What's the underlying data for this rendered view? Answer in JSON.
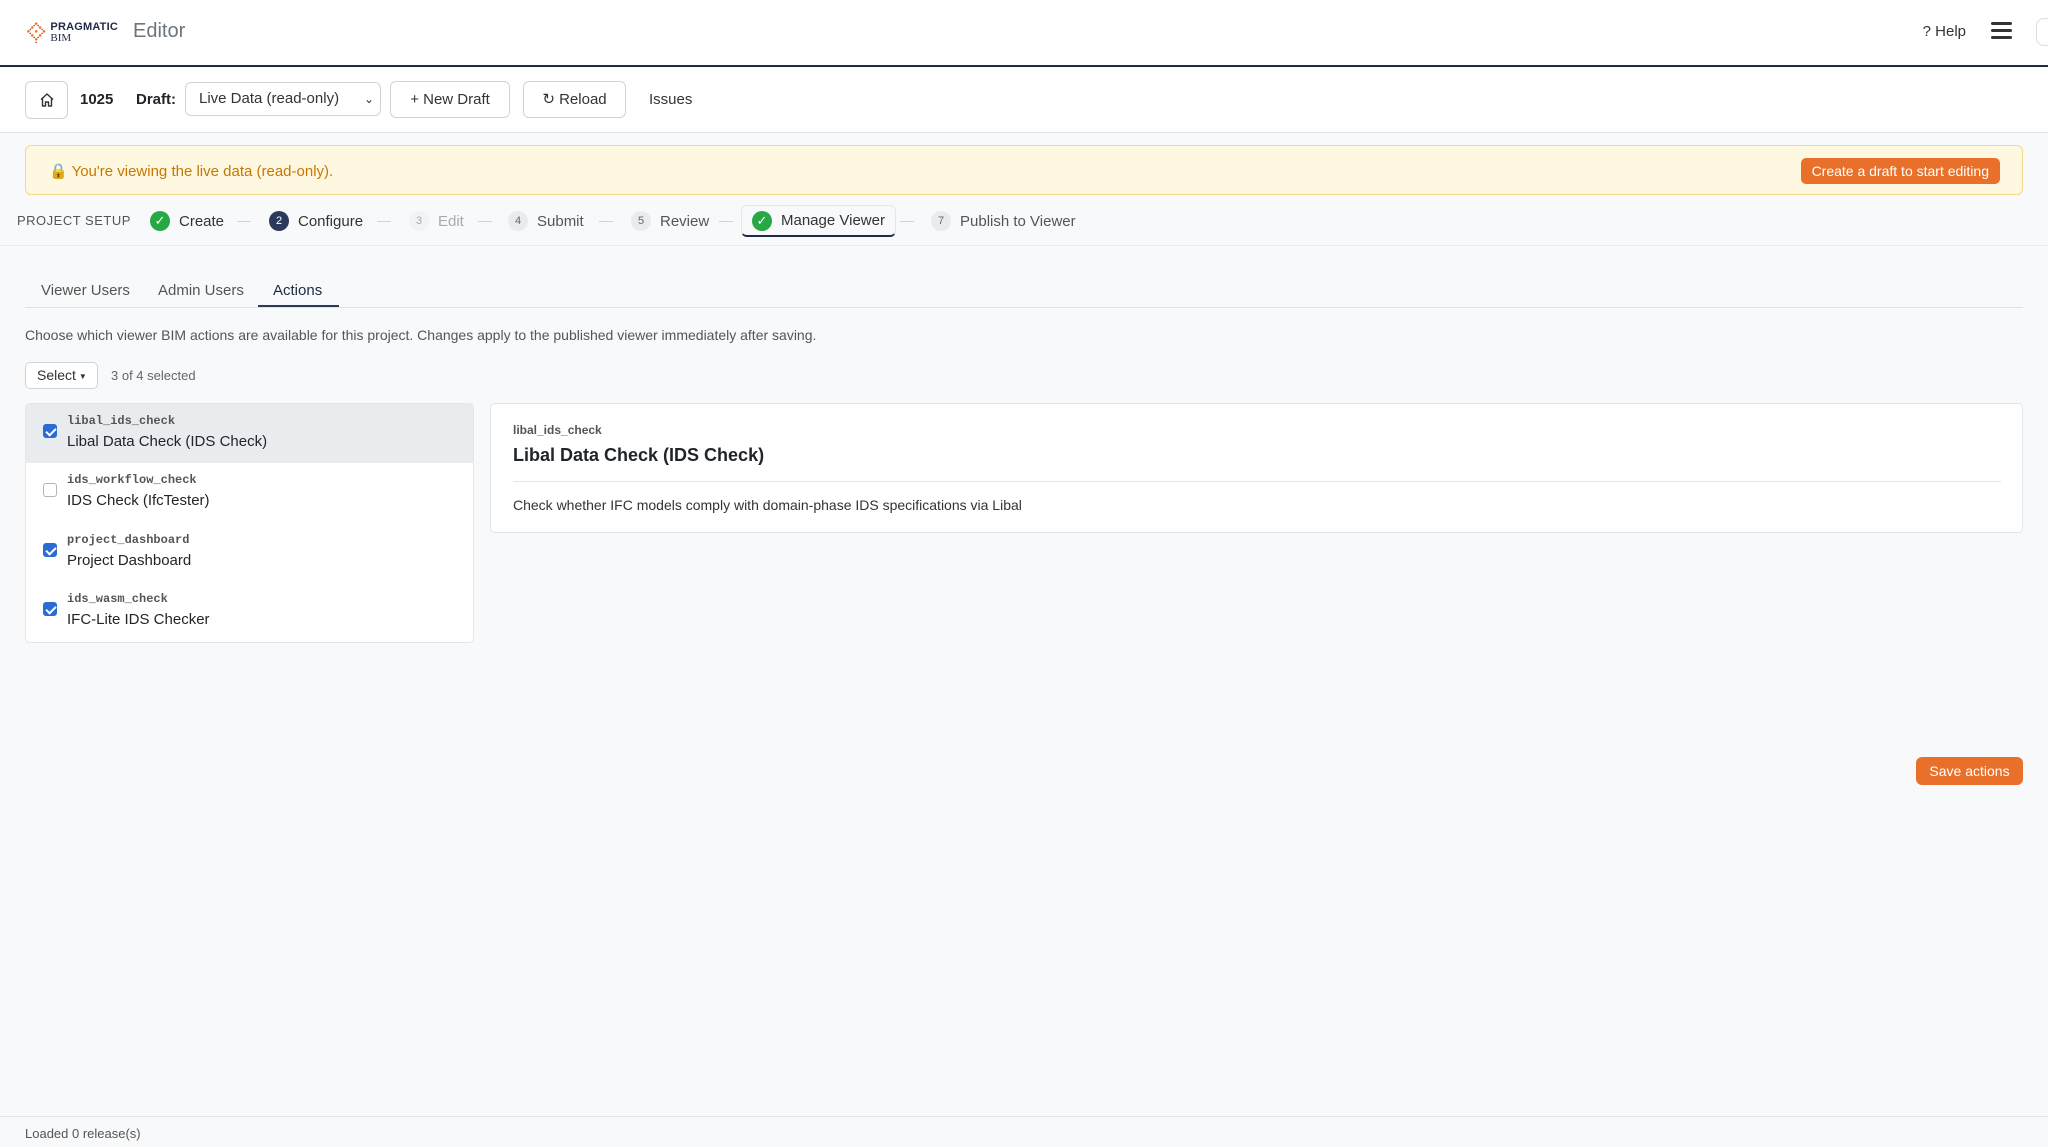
{
  "header": {
    "logo_line1": "PRAGMATIC",
    "logo_line2": "BIM",
    "app_title": "Editor",
    "help_label": "? Help",
    "menu_icon": "hamburger-icon"
  },
  "toolbar": {
    "home_icon": "home-icon",
    "project_id": "1025",
    "draft_label": "Draft:",
    "draft_value": "Live Data (read-only)",
    "new_draft_label": "+ New Draft",
    "reload_label": "↻ Reload",
    "issues_label": "Issues"
  },
  "alert": {
    "message": "🔒 You're viewing the live data (read-only).",
    "action_label": "Create a draft to start editing"
  },
  "stepper": {
    "title": "PROJECT SETUP",
    "steps": [
      {
        "badge": "✓",
        "label": "Create",
        "state": "done"
      },
      {
        "badge": "2",
        "label": "Configure",
        "state": "current"
      },
      {
        "badge": "3",
        "label": "Edit",
        "state": "disabled"
      },
      {
        "badge": "4",
        "label": "Submit",
        "state": "pending"
      },
      {
        "badge": "5",
        "label": "Review",
        "state": "pending"
      },
      {
        "badge": "✓",
        "label": "Manage Viewer",
        "state": "active"
      },
      {
        "badge": "7",
        "label": "Publish to Viewer",
        "state": "pending"
      }
    ]
  },
  "tabs": [
    {
      "label": "Viewer Users"
    },
    {
      "label": "Admin Users"
    },
    {
      "label": "Actions",
      "active": true
    }
  ],
  "description": "Choose which viewer BIM actions are available for this project. Changes apply to the published viewer immediately after saving.",
  "select": {
    "label": "Select",
    "count_text": "3 of 4 selected"
  },
  "actions": [
    {
      "key": "libal_ids_check",
      "name": "Libal Data Check (IDS Check)",
      "checked": true,
      "selected": true
    },
    {
      "key": "ids_workflow_check",
      "name": "IDS Check (IfcTester)",
      "checked": false,
      "selected": false
    },
    {
      "key": "project_dashboard",
      "name": "Project Dashboard",
      "checked": true,
      "selected": false
    },
    {
      "key": "ids_wasm_check",
      "name": "IFC-Lite IDS Checker",
      "checked": true,
      "selected": false
    }
  ],
  "detail": {
    "key": "libal_ids_check",
    "title": "Libal Data Check (IDS Check)",
    "description": "Check whether IFC models comply with domain-phase IDS specifications via Libal"
  },
  "save_label": "Save actions",
  "footer": {
    "status": "Loaded 0 release(s)"
  },
  "colors": {
    "accent": "#e8702a",
    "navy": "#1f2a44",
    "success": "#28a745",
    "checkbox": "#2b6cd4"
  }
}
